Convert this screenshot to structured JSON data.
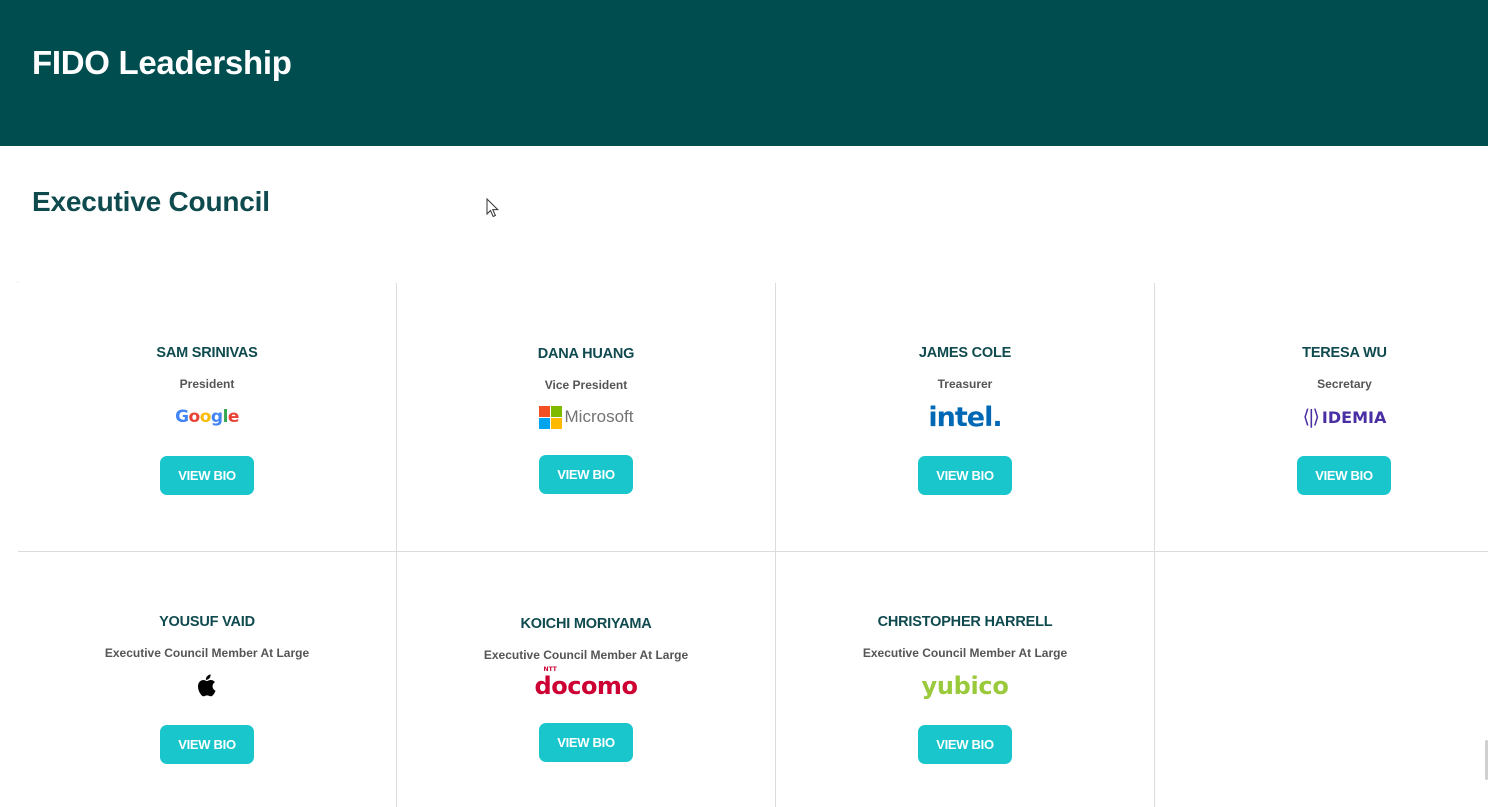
{
  "header": {
    "title": "FIDO Leadership"
  },
  "section": {
    "title": "Executive Council"
  },
  "members": [
    {
      "name": "SAM SRINIVAS",
      "role": "President",
      "company": "Google",
      "logo": "google-logo",
      "button": "VIEW BIO"
    },
    {
      "name": "DANA HUANG",
      "role": "Vice President",
      "company": "Microsoft",
      "logo": "microsoft-logo",
      "button": "VIEW BIO"
    },
    {
      "name": "JAMES COLE",
      "role": "Treasurer",
      "company": "intel.",
      "logo": "intel-logo",
      "button": "VIEW BIO"
    },
    {
      "name": "TERESA WU",
      "role": "Secretary",
      "company": "IDEMIA",
      "logo_mark": "⟨|⟩",
      "logo": "idemia-logo",
      "button": "VIEW BIO"
    },
    {
      "name": "YOUSUF VAID",
      "role": "Executive Council Member At Large",
      "company": "Apple",
      "logo": "apple-logo",
      "button": "VIEW BIO"
    },
    {
      "name": "KOICHI MORIYAMA",
      "role": "Executive Council Member At Large",
      "company": "docomo",
      "logo_super": "NTT",
      "logo": "docomo-logo",
      "button": "VIEW BIO"
    },
    {
      "name": "CHRISTOPHER HARRELL",
      "role": "Executive Council Member At Large",
      "company": "yubico",
      "logo": "yubico-logo",
      "button": "VIEW BIO"
    }
  ],
  "colors": {
    "header_bg": "#004d4f",
    "title_text": "#0f4a4f",
    "button_bg": "#18c6cc",
    "button_text": "#ffffff"
  }
}
